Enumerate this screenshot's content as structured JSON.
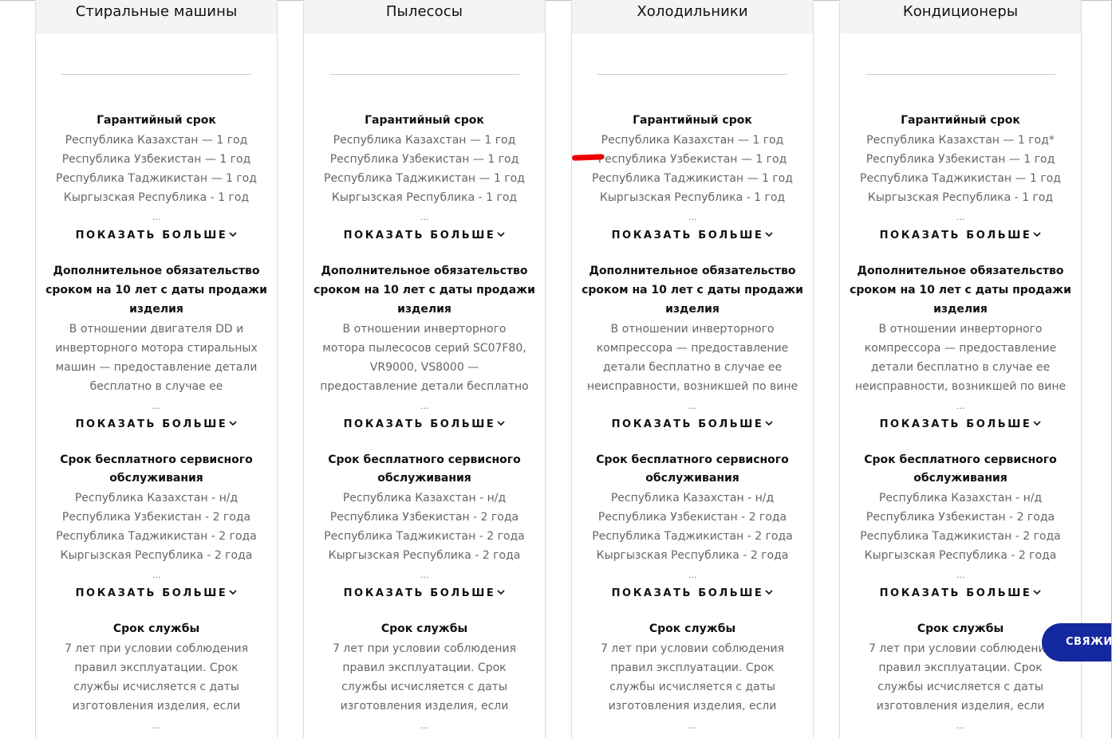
{
  "cards": [
    {
      "title": "Стиральные машины",
      "warranty": {
        "title": "Гарантийный срок",
        "lines": [
          "Республика Казахстан — 1 год",
          "Республика Узбекистан — 1 год",
          "Республика Таджикистан — 1 год",
          "Кыргызская Республика - 1 год"
        ]
      },
      "extra": {
        "title_lines": [
          "Дополнительное обязательство",
          "сроком на 10 лет с даты продажи",
          "изделия"
        ],
        "lines": [
          "В отношении двигателя DD и",
          "инверторного мотора стиральных",
          "машин — предоставление детали",
          "бесплатно в случае ее"
        ]
      },
      "service": {
        "title_lines": [
          "Срок бесплатного сервисного",
          "обслуживания"
        ],
        "lines": [
          "Республика Казахстан - н/д",
          "Республика Узбекистан - 2 года",
          "Республика Таджикистан - 2 года",
          "Кыргызская Республика - 2 года"
        ]
      },
      "life": {
        "title": "Срок службы",
        "lines": [
          "7 лет при условии соблюдения",
          "правил эксплуатации. Срок",
          "службы исчисляется с даты",
          "изготовления изделия, если"
        ]
      }
    },
    {
      "title": "Пылесосы",
      "warranty": {
        "title": "Гарантийный срок",
        "lines": [
          "Республика Казахстан — 1 год",
          "Республика Узбекистан — 1 год",
          "Республика Таджикистан — 1 год",
          "Кыргызская Республика - 1 год"
        ]
      },
      "extra": {
        "title_lines": [
          "Дополнительное обязательство",
          "сроком на 10 лет с даты продажи",
          "изделия"
        ],
        "lines": [
          "В отношении инверторного",
          "мотора пылесосов серий SC07F80,",
          "VR9000, VS8000 —",
          "предоставление детали бесплатно"
        ]
      },
      "service": {
        "title_lines": [
          "Срок бесплатного сервисного",
          "обслуживания"
        ],
        "lines": [
          "Республика Казахстан - н/д",
          "Республика Узбекистан - 2 года",
          "Республика Таджикистан - 2 года",
          "Кыргызская Республика - 2 года"
        ]
      },
      "life": {
        "title": "Срок службы",
        "lines": [
          "7 лет при условии соблюдения",
          "правил эксплуатации. Срок",
          "службы исчисляется с даты",
          "изготовления изделия, если"
        ]
      }
    },
    {
      "title": "Холодильники",
      "warranty": {
        "title": "Гарантийный срок",
        "lines": [
          "Республика Казахстан — 1 год",
          "Республика Узбекистан — 1 год",
          "Республика Таджикистан — 1 год",
          "Кыргызская Республика - 1 год"
        ]
      },
      "extra": {
        "title_lines": [
          "Дополнительное обязательство",
          "сроком на 10 лет с даты продажи",
          "изделия"
        ],
        "lines": [
          "В отношении инверторного",
          "компрессора — предоставление",
          "детали бесплатно в случае ее",
          "неисправности, возникшей по вине"
        ]
      },
      "service": {
        "title_lines": [
          "Срок бесплатного сервисного",
          "обслуживания"
        ],
        "lines": [
          "Республика Казахстан - н/д",
          "Республика Узбекистан - 2 года",
          "Республика Таджикистан - 2 года",
          "Кыргызская Республика - 2 года"
        ]
      },
      "life": {
        "title": "Срок службы",
        "lines": [
          "7 лет при условии соблюдения",
          "правил эксплуатации. Срок",
          "службы исчисляется с даты",
          "изготовления изделия, если"
        ]
      }
    },
    {
      "title": "Кондиционеры",
      "warranty": {
        "title": "Гарантийный срок",
        "lines": [
          "Республика Казахстан — 1 год*",
          "Республика Узбекистан — 1 год",
          "Республика Таджикистан — 1 год",
          "Кыргызская Республика - 1 год"
        ]
      },
      "extra": {
        "title_lines": [
          "Дополнительное обязательство",
          "сроком на 10 лет с даты продажи",
          "изделия"
        ],
        "lines": [
          "В отношении инверторного",
          "компрессора — предоставление",
          "детали бесплатно в случае ее",
          "неисправности, возникшей по вине"
        ]
      },
      "service": {
        "title_lines": [
          "Срок бесплатного сервисного",
          "обслуживания"
        ],
        "lines": [
          "Республика Казахстан - н/д",
          "Республика Узбекистан - 2 года",
          "Республика Таджикистан - 2 года",
          "Кыргызская Республика - 2 года"
        ]
      },
      "life": {
        "title": "Срок службы",
        "lines": [
          "7 лет при условии соблюдения",
          "правил эксплуатации. Срок",
          "службы исчисляется с даты",
          "изготовления изделия, если"
        ]
      }
    }
  ],
  "ellipsis": "...",
  "show_more_label": "ПОКАЗАТЬ БОЛЬШЕ",
  "show_more_icon": "chevron-down-icon",
  "chat_button": {
    "label": "СВЯЖИТЕ",
    "color": "#1428a0"
  },
  "annotation_mark": {
    "color": "#ee0000"
  }
}
